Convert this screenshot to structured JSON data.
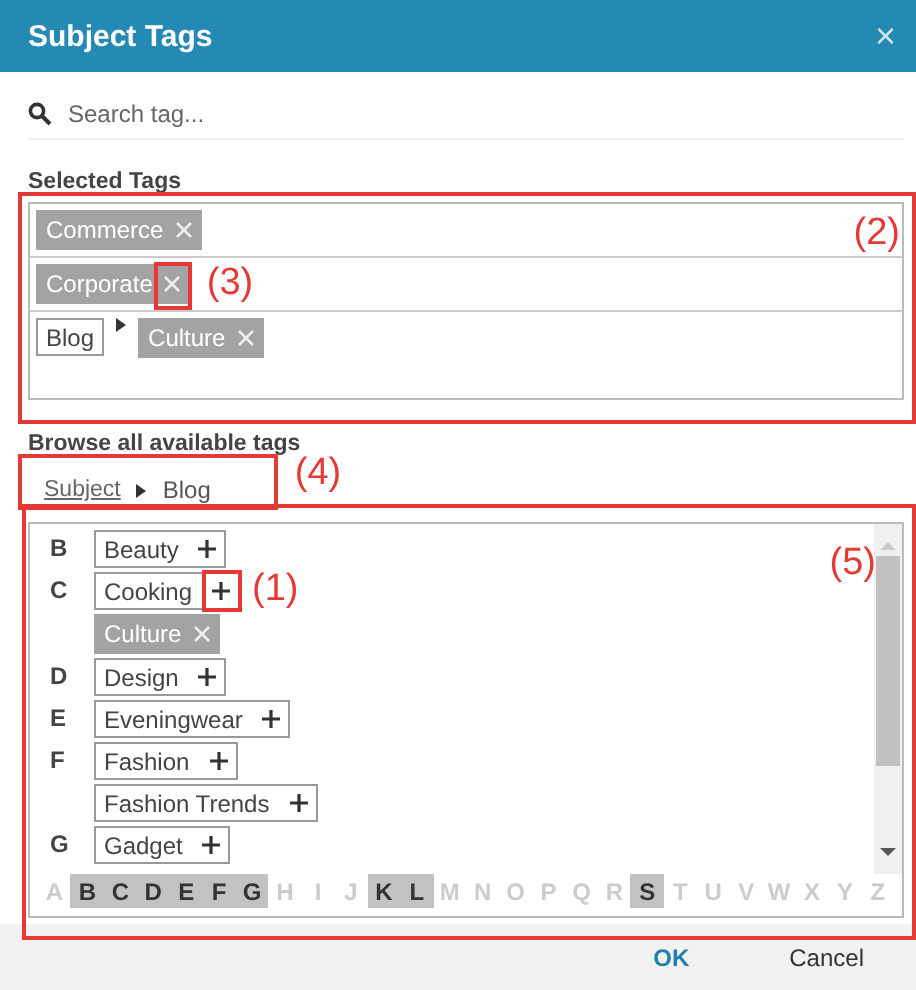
{
  "window": {
    "title": "Subject Tags",
    "close": "×"
  },
  "search": {
    "placeholder": "Search tag..."
  },
  "selected_tags": {
    "label": "Selected Tags",
    "callout": "(2)",
    "rows": [
      {
        "tag": "Commerce"
      },
      {
        "tag": "Corporate",
        "callout": "(3)"
      },
      {
        "parent": "Blog",
        "tag": "Culture"
      }
    ]
  },
  "browse": {
    "label": "Browse all available tags",
    "breadcrumb": [
      "Subject",
      "Blog"
    ],
    "breadcrumb_callout": "(4)",
    "list_callout": "(5)",
    "groups": [
      {
        "letter": "B",
        "tags": [
          {
            "label": "Beauty",
            "selected": false
          }
        ]
      },
      {
        "letter": "C",
        "tags": [
          {
            "label": "Cooking",
            "selected": false,
            "callout": "(1)"
          },
          {
            "label": "Culture",
            "selected": true
          }
        ]
      },
      {
        "letter": "D",
        "tags": [
          {
            "label": "Design",
            "selected": false
          }
        ]
      },
      {
        "letter": "E",
        "tags": [
          {
            "label": "Eveningwear",
            "selected": false
          }
        ]
      },
      {
        "letter": "F",
        "tags": [
          {
            "label": "Fashion",
            "selected": false
          },
          {
            "label": "Fashion Trends",
            "selected": false
          }
        ]
      },
      {
        "letter": "G",
        "tags": [
          {
            "label": "Gadget",
            "selected": false
          }
        ]
      }
    ],
    "alphabet": [
      {
        "letter": "A",
        "available": false
      },
      {
        "letter": "B",
        "available": true
      },
      {
        "letter": "C",
        "available": true
      },
      {
        "letter": "D",
        "available": true
      },
      {
        "letter": "E",
        "available": true
      },
      {
        "letter": "F",
        "available": true
      },
      {
        "letter": "G",
        "available": true
      },
      {
        "letter": "H",
        "available": false
      },
      {
        "letter": "I",
        "available": false
      },
      {
        "letter": "J",
        "available": false
      },
      {
        "letter": "K",
        "available": true
      },
      {
        "letter": "L",
        "available": true
      },
      {
        "letter": "M",
        "available": false
      },
      {
        "letter": "N",
        "available": false
      },
      {
        "letter": "O",
        "available": false
      },
      {
        "letter": "P",
        "available": false
      },
      {
        "letter": "Q",
        "available": false
      },
      {
        "letter": "R",
        "available": false
      },
      {
        "letter": "S",
        "available": true
      },
      {
        "letter": "T",
        "available": false
      },
      {
        "letter": "U",
        "available": false
      },
      {
        "letter": "V",
        "available": false
      },
      {
        "letter": "W",
        "available": false
      },
      {
        "letter": "X",
        "available": false
      },
      {
        "letter": "Y",
        "available": false
      },
      {
        "letter": "Z",
        "available": false
      }
    ]
  },
  "buttons": [
    {
      "label": "OK",
      "primary": true
    },
    {
      "label": "Cancel",
      "primary": false
    }
  ]
}
